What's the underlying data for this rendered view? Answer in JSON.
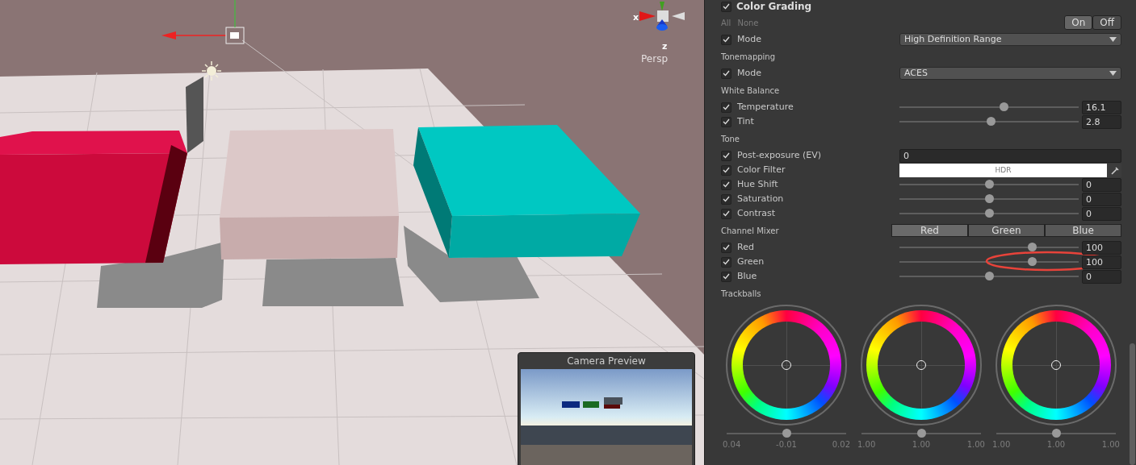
{
  "scene": {
    "gizmo": {
      "x_label": "x",
      "z_label": "z",
      "projection": "Persp"
    },
    "camera_preview": {
      "title": "Camera Preview"
    }
  },
  "inspector": {
    "header": {
      "title": "Color Grading",
      "enabled": true
    },
    "select_links": [
      "All",
      "None"
    ],
    "toggle": [
      {
        "label": "On",
        "selected": true
      },
      {
        "label": "Off",
        "selected": false
      }
    ],
    "sections": [
      {
        "rows": [
          {
            "kind": "dropdown",
            "label": "Mode",
            "checked": true,
            "value": "High Definition Range"
          }
        ]
      },
      {
        "title": "Tonemapping",
        "rows": [
          {
            "kind": "dropdown",
            "label": "Mode",
            "checked": true,
            "value": "ACES"
          }
        ]
      },
      {
        "title": "White Balance",
        "rows": [
          {
            "kind": "slider",
            "label": "Temperature",
            "checked": true,
            "level": 0.58,
            "value": "16.1"
          },
          {
            "kind": "slider",
            "label": "Tint",
            "checked": true,
            "level": 0.51,
            "value": "2.8"
          }
        ]
      },
      {
        "title": "Tone",
        "rows": [
          {
            "kind": "number",
            "label": "Post-exposure (EV)",
            "checked": true,
            "value": "0"
          },
          {
            "kind": "color",
            "label": "Color Filter",
            "checked": true,
            "value": "HDR"
          },
          {
            "kind": "slider",
            "label": "Hue Shift",
            "checked": true,
            "level": 0.5,
            "value": "0"
          },
          {
            "kind": "slider",
            "label": "Saturation",
            "checked": true,
            "level": 0.5,
            "value": "0"
          },
          {
            "kind": "slider",
            "label": "Contrast",
            "checked": true,
            "level": 0.5,
            "value": "0"
          }
        ]
      },
      {
        "title": "Channel Mixer",
        "tabs": [
          {
            "label": "Red",
            "selected": true
          },
          {
            "label": "Green",
            "selected": false
          },
          {
            "label": "Blue",
            "selected": false
          }
        ],
        "rows": [
          {
            "kind": "slider",
            "label": "Red",
            "checked": true,
            "level": 0.74,
            "value": "100"
          },
          {
            "kind": "slider",
            "label": "Green",
            "checked": true,
            "level": 0.74,
            "value": "100"
          },
          {
            "kind": "slider",
            "label": "Blue",
            "checked": true,
            "level": 0.5,
            "value": "0"
          }
        ]
      },
      {
        "title": "Trackballs",
        "trackballs": [
          {
            "level": 0.5,
            "labels": [
              "0.04",
              "-0.01",
              "0.02"
            ]
          },
          {
            "level": 0.5,
            "labels": [
              "1.00",
              "1.00",
              "1.00"
            ]
          },
          {
            "level": 0.5,
            "labels": [
              "1.00",
              "1.00",
              "1.00"
            ]
          }
        ]
      }
    ]
  }
}
